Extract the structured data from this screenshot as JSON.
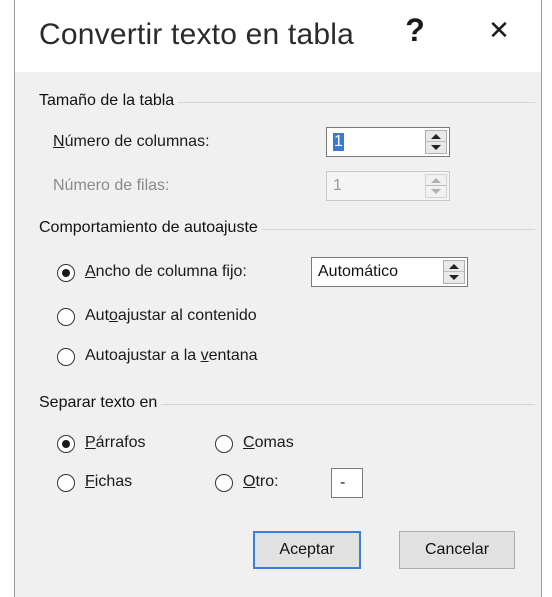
{
  "dialog": {
    "title": "Convertir texto en tabla",
    "help_label": "?",
    "close_label": "✕"
  },
  "table_size": {
    "section_title": "Tamaño de la tabla",
    "columns": {
      "label_accel": "N",
      "label_rest": "úmero de columnas:",
      "value": "1"
    },
    "rows": {
      "label": "Número de filas:",
      "value": "1"
    }
  },
  "autofit": {
    "section_title": "Comportamiento de autoajuste",
    "fixed_width": {
      "label_accel": "A",
      "label_rest": "ncho de columna fijo:",
      "value": "Automático",
      "checked": true
    },
    "fit_contents": {
      "label_pre": "Aut",
      "label_accel": "o",
      "label_rest": "ajustar al contenido",
      "checked": false
    },
    "fit_window": {
      "label_pre": "Autoajustar a la ",
      "label_accel": "v",
      "label_rest": "entana",
      "checked": false
    }
  },
  "separate": {
    "section_title": "Separar texto en",
    "paragraphs": {
      "label_accel": "P",
      "label_rest": "árrafos",
      "checked": true
    },
    "commas": {
      "label_accel": "C",
      "label_rest": "omas",
      "checked": false
    },
    "tabs": {
      "label_accel": "F",
      "label_rest": "ichas",
      "checked": false
    },
    "other": {
      "label_accel": "O",
      "label_rest": "tro:",
      "checked": false,
      "value": "-"
    }
  },
  "buttons": {
    "ok": "Aceptar",
    "cancel": "Cancelar"
  }
}
